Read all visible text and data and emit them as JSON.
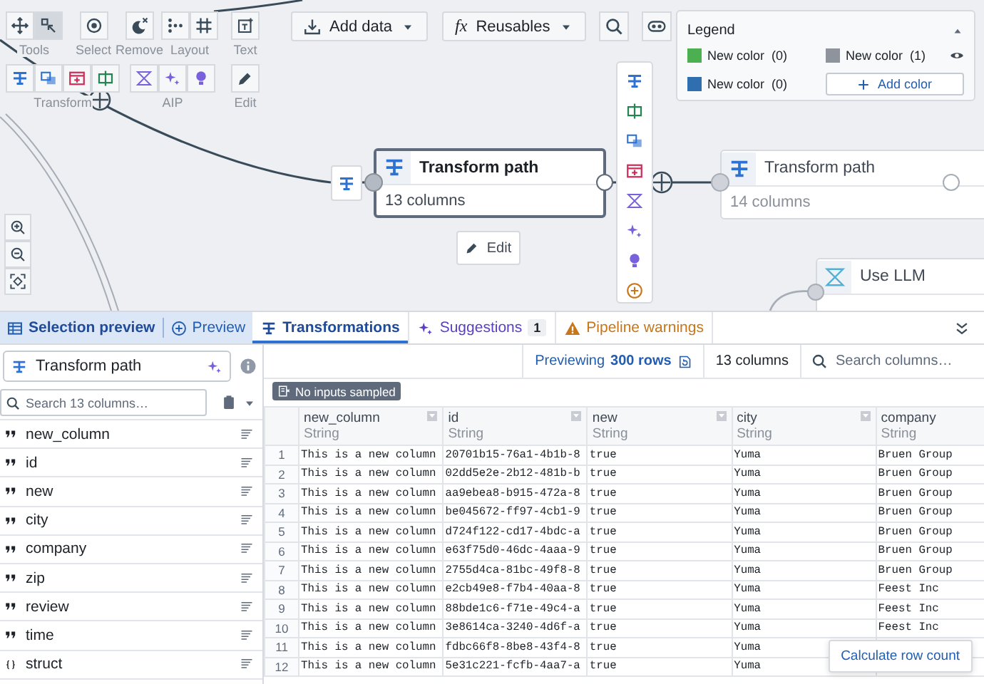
{
  "canvas_toolbar": [
    {
      "label": "Tools",
      "kind": "tools"
    },
    {
      "label": "Select",
      "kind": "select"
    },
    {
      "label": "Remove",
      "kind": "remove"
    },
    {
      "label": "Layout",
      "kind": "layout"
    },
    {
      "label": "Text",
      "kind": "text"
    },
    {
      "label": "Transform",
      "kind": "transform"
    },
    {
      "label": "AIP",
      "kind": "aip"
    },
    {
      "label": "Edit",
      "kind": "edit"
    }
  ],
  "top_buttons": [
    {
      "label": "Add data",
      "kind": "add"
    },
    {
      "label": "Reusables",
      "kind": "fx",
      "prefix": "fx"
    }
  ],
  "legend": {
    "title": "Legend",
    "items": [
      {
        "label": "New color",
        "count": "(0)",
        "color": "#4caf50"
      },
      {
        "label": "New color",
        "count": "(1)",
        "color": "#8f949c"
      },
      {
        "label": "New color",
        "count": "(0)",
        "color": "#2f6fb0"
      }
    ],
    "add_button": "Add color"
  },
  "nodes": [
    {
      "title": "Transform path",
      "subtitle": "13 columns",
      "kind": "transform",
      "selected": true
    },
    {
      "title": "Transform path",
      "subtitle": "14 columns",
      "kind": "transform",
      "selected": false
    },
    {
      "title": "Use LLM",
      "kind": "llm",
      "selected": false
    }
  ],
  "edit_button": "Edit",
  "preview_toggle": [
    {
      "label": "Selection preview",
      "selected": true
    },
    {
      "label": "Preview",
      "selected": false
    }
  ],
  "tabs": [
    {
      "label": "Transformations",
      "kind": "transform",
      "selected": true
    },
    {
      "label": "Suggestions",
      "kind": "suggestions",
      "badge": "1",
      "selected": false
    },
    {
      "label": "Pipeline warnings",
      "kind": "warnings",
      "selected": false
    }
  ],
  "transform_name": "Transform path",
  "column_search": {
    "placeholder": "Search 13 columns…"
  },
  "columns": [
    {
      "name": "new_column",
      "kind": "string"
    },
    {
      "name": "id",
      "kind": "string"
    },
    {
      "name": "new",
      "kind": "string"
    },
    {
      "name": "city",
      "kind": "string"
    },
    {
      "name": "company",
      "kind": "string"
    },
    {
      "name": "zip",
      "kind": "string"
    },
    {
      "name": "review",
      "kind": "string"
    },
    {
      "name": "time",
      "kind": "string"
    },
    {
      "name": "struct",
      "kind": "struct"
    }
  ],
  "preview_bar": {
    "label": "Previewing",
    "rows": "300 rows",
    "columns": "13 columns",
    "search_placeholder": "Search columns…"
  },
  "sample_badge": "No inputs sampled",
  "table": {
    "columns": [
      {
        "name": "new_column",
        "type": "String"
      },
      {
        "name": "id",
        "type": "String"
      },
      {
        "name": "new",
        "type": "String"
      },
      {
        "name": "city",
        "type": "String"
      },
      {
        "name": "company",
        "type": "String"
      }
    ],
    "rows": [
      {
        "index": "1",
        "cells": [
          "This is a new column",
          "20701b15-76a1-4b1b-8",
          "true",
          "Yuma",
          "Bruen Group"
        ]
      },
      {
        "index": "2",
        "cells": [
          "This is a new column",
          "02dd5e2e-2b12-481b-b",
          "true",
          "Yuma",
          "Bruen Group"
        ]
      },
      {
        "index": "3",
        "cells": [
          "This is a new column",
          "aa9ebea8-b915-472a-8",
          "true",
          "Yuma",
          "Bruen Group"
        ]
      },
      {
        "index": "4",
        "cells": [
          "This is a new column",
          "be045672-ff97-4cb1-9",
          "true",
          "Yuma",
          "Bruen Group"
        ]
      },
      {
        "index": "5",
        "cells": [
          "This is a new column",
          "d724f122-cd17-4bdc-a",
          "true",
          "Yuma",
          "Bruen Group"
        ]
      },
      {
        "index": "6",
        "cells": [
          "This is a new column",
          "e63f75d0-46dc-4aaa-9",
          "true",
          "Yuma",
          "Bruen Group"
        ]
      },
      {
        "index": "7",
        "cells": [
          "This is a new column",
          "2755d4ca-81bc-49f8-8",
          "true",
          "Yuma",
          "Bruen Group"
        ]
      },
      {
        "index": "8",
        "cells": [
          "This is a new column",
          "e2cb49e8-f7b4-40aa-8",
          "true",
          "Yuma",
          "Feest Inc"
        ]
      },
      {
        "index": "9",
        "cells": [
          "This is a new column",
          "88bde1c6-f71e-49c4-a",
          "true",
          "Yuma",
          "Feest Inc"
        ]
      },
      {
        "index": "10",
        "cells": [
          "This is a new column",
          "3e8614ca-3240-4d6f-a",
          "true",
          "Yuma",
          "Feest Inc"
        ]
      },
      {
        "index": "11",
        "cells": [
          "This is a new column",
          "fdbc66f8-8be8-43f4-8",
          "true",
          "Yuma"
        ]
      },
      {
        "index": "12",
        "cells": [
          "This is a new column",
          "5e31c221-fcfb-4aa7-a",
          "true",
          "Yuma"
        ]
      }
    ]
  },
  "popup": "Calculate row count"
}
